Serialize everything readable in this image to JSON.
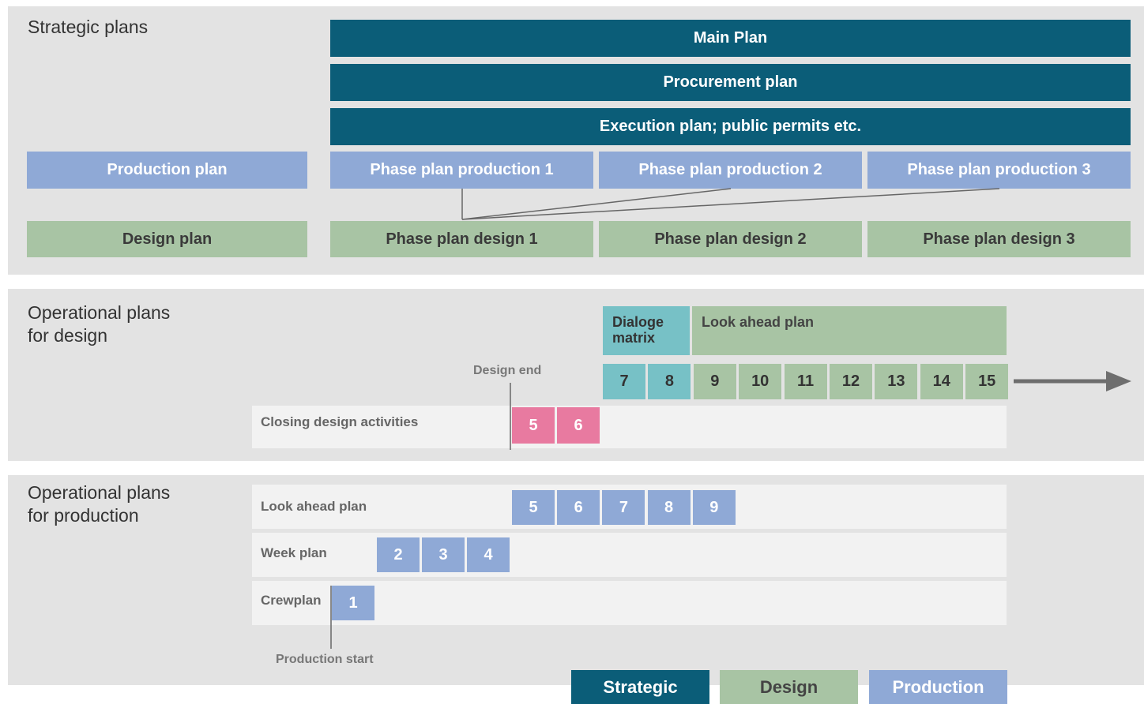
{
  "strategic": {
    "title": "Strategic plans",
    "main_plan": "Main Plan",
    "procurement_plan": "Procurement plan",
    "execution_plan": "Execution plan; public permits etc.",
    "production_plan": "Production plan",
    "design_plan": "Design plan",
    "phase_production": [
      "Phase plan production 1",
      "Phase plan production 2",
      "Phase plan production 3"
    ],
    "phase_design": [
      "Phase plan design 1",
      "Phase plan design 2",
      "Phase plan design 3"
    ]
  },
  "op_design": {
    "title": "Operational plans\nfor design",
    "dialoge_matrix": "Dialoge\nmatrix",
    "look_ahead": "Look ahead plan",
    "weeks": [
      "7",
      "8",
      "9",
      "10",
      "11",
      "12",
      "13",
      "14",
      "15"
    ],
    "design_end": "Design end",
    "closing_label": "Closing design activities",
    "closing_weeks": [
      "5",
      "6"
    ]
  },
  "op_production": {
    "title": "Operational plans\nfor production",
    "look_ahead_label": "Look ahead plan",
    "look_ahead_weeks": [
      "5",
      "6",
      "7",
      "8",
      "9"
    ],
    "week_plan_label": "Week plan",
    "week_plan_weeks": [
      "2",
      "3",
      "4"
    ],
    "crewplan_label": "Crewplan",
    "crewplan_weeks": [
      "1"
    ],
    "production_start": "Production start"
  },
  "legend": {
    "strategic": "Strategic",
    "design": "Design",
    "production": "Production"
  },
  "colors": {
    "strategic": "#0b5d78",
    "production": "#8fa9d6",
    "design": "#a8c4a4",
    "dialoge": "#77c1c6",
    "closing": "#e87aa0"
  }
}
